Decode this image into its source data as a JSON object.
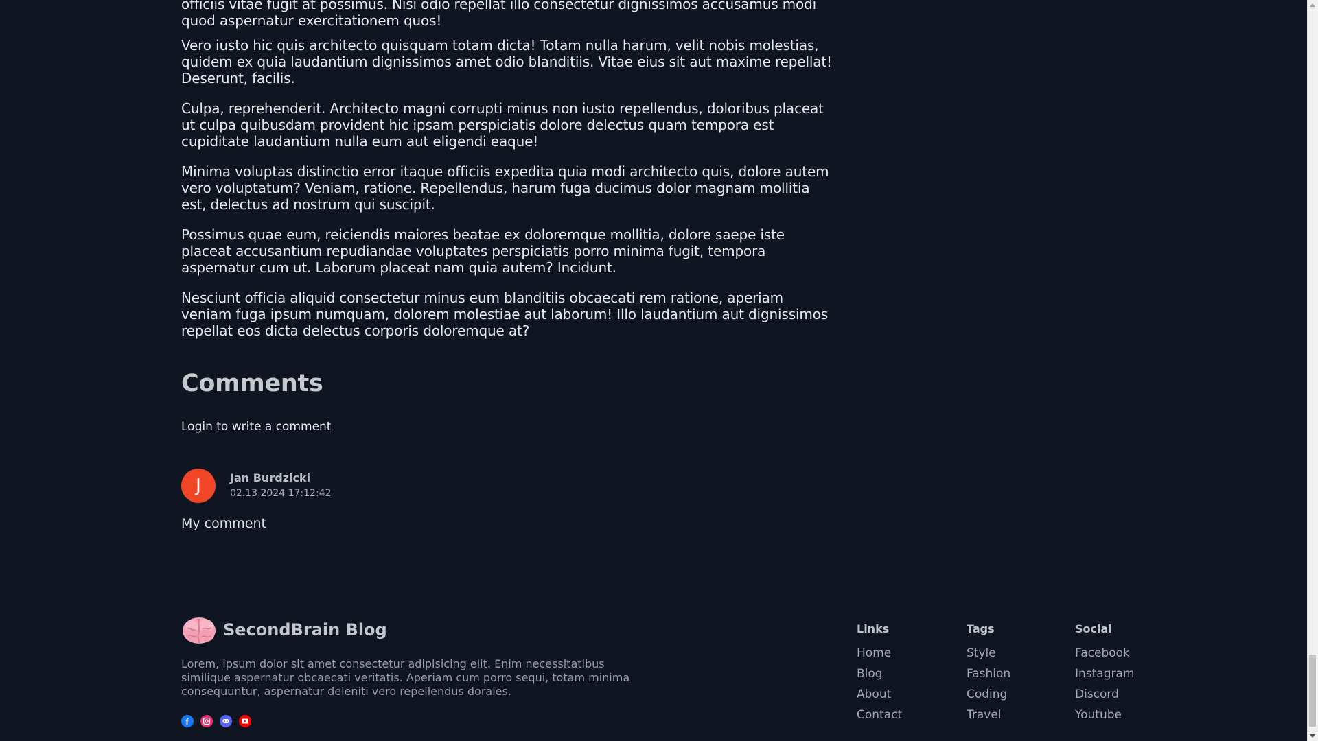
{
  "article": {
    "paragraphs": [
      "officiis vitae fugit at possimus. Nisi odio repellat illo consectetur dignissimos accusamus modi quod aspernatur exercitationem quos!",
      "Vero iusto hic quis architecto quisquam totam dicta! Totam nulla harum, velit nobis molestias, quidem ex quia laudantium dignissimos amet odio blanditiis. Vitae eius sit aut maxime repellat! Deserunt, facilis.",
      "Culpa, reprehenderit. Architecto magni corrupti minus non iusto repellendus, doloribus placeat ut culpa quibusdam provident hic ipsam perspiciatis dolore delectus quam tempora est cupiditate laudantium nulla eum aut eligendi eaque!",
      "Minima voluptas distinctio error itaque officiis expedita quia modi architecto quis, dolore autem vero voluptatum? Veniam, ratione. Repellendus, harum fuga ducimus dolor magnam mollitia est, delectus ad nostrum qui suscipit.",
      "Possimus quae eum, reiciendis maiores beatae ex doloremque mollitia, dolore saepe iste placeat accusantium repudiandae voluptates perspiciatis porro minima fugit, tempora aspernatur cum ut. Laborum placeat nam quia autem? Incidunt.",
      "Nesciunt officia aliquid consectetur minus eum blanditiis obcaecati rem ratione, aperiam veniam fuga ipsum numquam, dolorem molestiae aut laborum! Illo laudantium aut dignissimos repellat eos dicta delectus corporis doloremque at?"
    ]
  },
  "comments": {
    "title": "Comments",
    "login_label": "Login to write a comment",
    "items": [
      {
        "avatar_letter": "J",
        "avatar_color": "#f04526",
        "author": "Jan Burdzicki",
        "date": "02.13.2024 17:12:42",
        "text": "My comment"
      }
    ]
  },
  "footer": {
    "brand_name": "SecondBrain Blog",
    "brand_icon": "brain-icon",
    "description": "Lorem, ipsum dolor sit amet consectetur adipisicing elit. Enim necessitatibus similique aspernatur obcaecati veritatis. Aperiam cum porro sequi, totam minima consequuntur, aspernatur deleniti vero repellendus dorales.",
    "social_icons": [
      {
        "name": "facebook-icon",
        "color": "#1877f2"
      },
      {
        "name": "instagram-icon",
        "color": "#e1306c"
      },
      {
        "name": "discord-icon",
        "color": "#5865f2"
      },
      {
        "name": "youtube-icon",
        "color": "#ff0000"
      }
    ],
    "columns": {
      "links": {
        "title": "Links",
        "items": [
          "Home",
          "Blog",
          "About",
          "Contact"
        ]
      },
      "tags": {
        "title": "Tags",
        "items": [
          "Style",
          "Fashion",
          "Coding",
          "Travel"
        ]
      },
      "social": {
        "title": "Social",
        "items": [
          "Facebook",
          "Instagram",
          "Discord",
          "Youtube"
        ]
      }
    }
  },
  "colors": {
    "background": "#0f1521",
    "text": "#e7e8ec",
    "accent": "#f04526"
  }
}
